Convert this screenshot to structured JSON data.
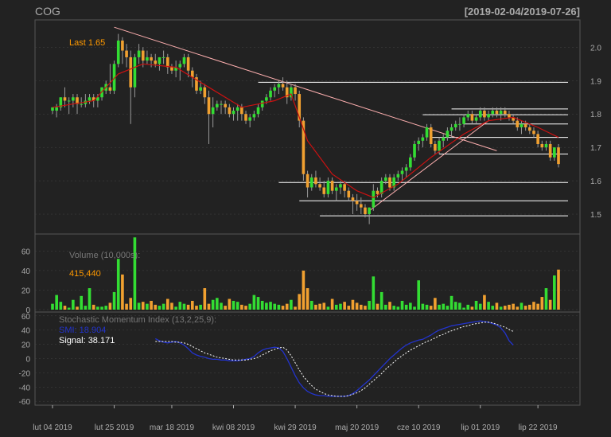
{
  "header": {
    "symbol": "COG",
    "date_range": "[2019-02-04/2019-07-26]"
  },
  "colors": {
    "background": "#222222",
    "grid": "#444444",
    "up": "#33dd33",
    "down": "#f0a030",
    "ma": "#cc1111",
    "trendline": "#ffb0b0",
    "hline": "#ffffff",
    "smi": "#2233cc",
    "signal": "#ffffff",
    "text": "#aaaaaa",
    "accent": "#ff9900"
  },
  "chart_data": [
    {
      "type": "candlestick",
      "title": "COG",
      "annotation": "Last 1.65",
      "ylim": [
        1.45,
        2.07
      ],
      "yticks": [
        "1.5",
        "1.6",
        "1.7",
        "1.8",
        "1.9",
        "2.0"
      ],
      "x_tick_labels": [
        "lut 04 2019",
        "lut 25 2019",
        "mar 18 2019",
        "kwi 08 2019",
        "kwi 29 2019",
        "maj 20 2019",
        "cze 10 2019",
        "lip 01 2019",
        "lip 22 2019"
      ],
      "x_tick_index": [
        0,
        15,
        29,
        44,
        59,
        74,
        89,
        104,
        118
      ],
      "n_bars": 124,
      "ohlc": [
        [
          1.81,
          1.82,
          1.8,
          1.82
        ],
        [
          1.81,
          1.83,
          1.79,
          1.82
        ],
        [
          1.82,
          1.85,
          1.81,
          1.85
        ],
        [
          1.85,
          1.88,
          1.82,
          1.84
        ],
        [
          1.84,
          1.85,
          1.8,
          1.84
        ],
        [
          1.84,
          1.86,
          1.82,
          1.85
        ],
        [
          1.85,
          1.86,
          1.8,
          1.83
        ],
        [
          1.83,
          1.85,
          1.82,
          1.83
        ],
        [
          1.83,
          1.86,
          1.82,
          1.84
        ],
        [
          1.84,
          1.86,
          1.83,
          1.85
        ],
        [
          1.85,
          1.86,
          1.82,
          1.84
        ],
        [
          1.84,
          1.86,
          1.82,
          1.85
        ],
        [
          1.85,
          1.88,
          1.84,
          1.88
        ],
        [
          1.87,
          1.9,
          1.86,
          1.89
        ],
        [
          1.88,
          1.95,
          1.86,
          1.87
        ],
        [
          1.87,
          1.96,
          1.86,
          1.95
        ],
        [
          1.95,
          2.04,
          1.94,
          2.02
        ],
        [
          2.02,
          2.03,
          1.95,
          1.99
        ],
        [
          1.99,
          2.01,
          1.94,
          1.97
        ],
        [
          1.97,
          1.99,
          1.77,
          1.88
        ],
        [
          1.88,
          1.98,
          1.85,
          1.97
        ],
        [
          1.97,
          2.01,
          1.95,
          1.99
        ],
        [
          1.99,
          2.0,
          1.94,
          1.96
        ],
        [
          1.96,
          1.99,
          1.95,
          1.97
        ],
        [
          1.97,
          1.98,
          1.94,
          1.96
        ],
        [
          1.96,
          1.98,
          1.94,
          1.95
        ],
        [
          1.95,
          1.97,
          1.93,
          1.97
        ],
        [
          1.97,
          1.99,
          1.95,
          1.97
        ],
        [
          1.97,
          1.98,
          1.92,
          1.94
        ],
        [
          1.94,
          1.95,
          1.92,
          1.93
        ],
        [
          1.93,
          1.96,
          1.91,
          1.94
        ],
        [
          1.94,
          1.96,
          1.9,
          1.95
        ],
        [
          1.95,
          1.98,
          1.94,
          1.97
        ],
        [
          1.97,
          1.98,
          1.91,
          1.93
        ],
        [
          1.93,
          1.94,
          1.88,
          1.91
        ],
        [
          1.91,
          1.92,
          1.86,
          1.87
        ],
        [
          1.87,
          1.9,
          1.86,
          1.88
        ],
        [
          1.88,
          1.89,
          1.83,
          1.85
        ],
        [
          1.85,
          1.87,
          1.71,
          1.8
        ],
        [
          1.8,
          1.85,
          1.76,
          1.82
        ],
        [
          1.82,
          1.84,
          1.81,
          1.83
        ],
        [
          1.83,
          1.84,
          1.8,
          1.83
        ],
        [
          1.83,
          1.84,
          1.8,
          1.82
        ],
        [
          1.82,
          1.83,
          1.79,
          1.8
        ],
        [
          1.8,
          1.82,
          1.78,
          1.81
        ],
        [
          1.81,
          1.83,
          1.78,
          1.82
        ],
        [
          1.82,
          1.83,
          1.78,
          1.8
        ],
        [
          1.8,
          1.81,
          1.77,
          1.78
        ],
        [
          1.78,
          1.8,
          1.76,
          1.79
        ],
        [
          1.79,
          1.81,
          1.78,
          1.8
        ],
        [
          1.8,
          1.83,
          1.79,
          1.82
        ],
        [
          1.82,
          1.84,
          1.81,
          1.84
        ],
        [
          1.84,
          1.86,
          1.83,
          1.85
        ],
        [
          1.85,
          1.88,
          1.84,
          1.87
        ],
        [
          1.87,
          1.89,
          1.85,
          1.88
        ],
        [
          1.88,
          1.9,
          1.86,
          1.89
        ],
        [
          1.89,
          1.91,
          1.87,
          1.88
        ],
        [
          1.88,
          1.9,
          1.83,
          1.85
        ],
        [
          1.85,
          1.89,
          1.84,
          1.88
        ],
        [
          1.88,
          1.89,
          1.84,
          1.86
        ],
        [
          1.86,
          1.87,
          1.76,
          1.78
        ],
        [
          1.78,
          1.79,
          1.6,
          1.62
        ],
        [
          1.62,
          1.63,
          1.55,
          1.58
        ],
        [
          1.58,
          1.62,
          1.57,
          1.61
        ],
        [
          1.61,
          1.63,
          1.58,
          1.59
        ],
        [
          1.59,
          1.61,
          1.57,
          1.58
        ],
        [
          1.58,
          1.6,
          1.55,
          1.56
        ],
        [
          1.56,
          1.61,
          1.55,
          1.6
        ],
        [
          1.6,
          1.61,
          1.56,
          1.57
        ],
        [
          1.57,
          1.59,
          1.54,
          1.58
        ],
        [
          1.58,
          1.6,
          1.56,
          1.59
        ],
        [
          1.59,
          1.6,
          1.55,
          1.57
        ],
        [
          1.57,
          1.58,
          1.54,
          1.55
        ],
        [
          1.55,
          1.56,
          1.5,
          1.54
        ],
        [
          1.54,
          1.56,
          1.51,
          1.53
        ],
        [
          1.53,
          1.55,
          1.5,
          1.52
        ],
        [
          1.52,
          1.53,
          1.49,
          1.5
        ],
        [
          1.5,
          1.52,
          1.47,
          1.52
        ],
        [
          1.52,
          1.59,
          1.51,
          1.57
        ],
        [
          1.57,
          1.58,
          1.55,
          1.56
        ],
        [
          1.56,
          1.61,
          1.55,
          1.6
        ],
        [
          1.6,
          1.62,
          1.59,
          1.61
        ],
        [
          1.61,
          1.62,
          1.57,
          1.58
        ],
        [
          1.58,
          1.62,
          1.57,
          1.61
        ],
        [
          1.61,
          1.63,
          1.6,
          1.62
        ],
        [
          1.62,
          1.64,
          1.6,
          1.63
        ],
        [
          1.63,
          1.65,
          1.61,
          1.64
        ],
        [
          1.64,
          1.68,
          1.63,
          1.67
        ],
        [
          1.67,
          1.72,
          1.66,
          1.71
        ],
        [
          1.71,
          1.73,
          1.69,
          1.72
        ],
        [
          1.72,
          1.74,
          1.7,
          1.73
        ],
        [
          1.73,
          1.77,
          1.72,
          1.76
        ],
        [
          1.76,
          1.77,
          1.7,
          1.71
        ],
        [
          1.71,
          1.72,
          1.68,
          1.69
        ],
        [
          1.69,
          1.73,
          1.68,
          1.72
        ],
        [
          1.72,
          1.74,
          1.7,
          1.73
        ],
        [
          1.73,
          1.76,
          1.72,
          1.75
        ],
        [
          1.75,
          1.77,
          1.73,
          1.76
        ],
        [
          1.76,
          1.78,
          1.75,
          1.77
        ],
        [
          1.77,
          1.79,
          1.75,
          1.77
        ],
        [
          1.77,
          1.8,
          1.76,
          1.79
        ],
        [
          1.79,
          1.81,
          1.78,
          1.8
        ],
        [
          1.8,
          1.81,
          1.77,
          1.78
        ],
        [
          1.78,
          1.8,
          1.77,
          1.79
        ],
        [
          1.79,
          1.82,
          1.78,
          1.81
        ],
        [
          1.81,
          1.82,
          1.78,
          1.79
        ],
        [
          1.79,
          1.81,
          1.78,
          1.8
        ],
        [
          1.8,
          1.82,
          1.79,
          1.81
        ],
        [
          1.81,
          1.82,
          1.79,
          1.8
        ],
        [
          1.8,
          1.82,
          1.78,
          1.81
        ],
        [
          1.81,
          1.82,
          1.79,
          1.8
        ],
        [
          1.8,
          1.81,
          1.78,
          1.79
        ],
        [
          1.79,
          1.8,
          1.77,
          1.78
        ],
        [
          1.78,
          1.79,
          1.75,
          1.76
        ],
        [
          1.76,
          1.78,
          1.74,
          1.77
        ],
        [
          1.77,
          1.78,
          1.75,
          1.76
        ],
        [
          1.76,
          1.77,
          1.74,
          1.75
        ],
        [
          1.75,
          1.76,
          1.73,
          1.74
        ],
        [
          1.74,
          1.75,
          1.7,
          1.71
        ],
        [
          1.71,
          1.72,
          1.69,
          1.7
        ],
        [
          1.7,
          1.72,
          1.69,
          1.71
        ],
        [
          1.71,
          1.72,
          1.66,
          1.67
        ],
        [
          1.67,
          1.7,
          1.66,
          1.7
        ],
        [
          1.7,
          1.71,
          1.64,
          1.65
        ]
      ],
      "ma_line": [
        [
          0,
          1.82
        ],
        [
          10,
          1.84
        ],
        [
          16,
          1.92
        ],
        [
          22,
          1.95
        ],
        [
          30,
          1.94
        ],
        [
          38,
          1.88
        ],
        [
          46,
          1.82
        ],
        [
          54,
          1.84
        ],
        [
          58,
          1.86
        ],
        [
          62,
          1.72
        ],
        [
          68,
          1.62
        ],
        [
          74,
          1.57
        ],
        [
          78,
          1.55
        ],
        [
          84,
          1.59
        ],
        [
          92,
          1.67
        ],
        [
          100,
          1.74
        ],
        [
          106,
          1.78
        ],
        [
          112,
          1.79
        ],
        [
          118,
          1.76
        ],
        [
          123,
          1.73
        ]
      ],
      "trendlines": [
        {
          "from": [
            15,
            2.06
          ],
          "to": [
            108,
            1.69
          ]
        },
        {
          "from": [
            77,
            1.51
          ],
          "to": [
            106,
            1.78
          ]
        }
      ],
      "hlines": [
        {
          "y": 1.895,
          "x_from": 50,
          "x_to": 123
        },
        {
          "y": 1.815,
          "x_from": 97,
          "x_to": 123
        },
        {
          "y": 1.798,
          "x_from": 90,
          "x_to": 123
        },
        {
          "y": 1.77,
          "x_from": 100,
          "x_to": 123
        },
        {
          "y": 1.73,
          "x_from": 92,
          "x_to": 123
        },
        {
          "y": 1.68,
          "x_from": 94,
          "x_to": 123
        },
        {
          "y": 1.595,
          "x_from": 55,
          "x_to": 123
        },
        {
          "y": 1.54,
          "x_from": 60,
          "x_to": 123
        },
        {
          "y": 1.495,
          "x_from": 65,
          "x_to": 123
        }
      ]
    },
    {
      "type": "bar",
      "title": "Volume (10,000s):",
      "annotation": "415,440",
      "ylim": [
        0,
        75
      ],
      "yticks": [
        "0",
        "20",
        "40",
        "60"
      ],
      "volume": [
        6,
        15,
        8,
        4,
        2,
        10,
        3,
        14,
        4,
        22,
        5,
        3,
        3,
        4,
        7,
        18,
        52,
        36,
        6,
        12,
        74,
        7,
        8,
        6,
        9,
        5,
        4,
        6,
        11,
        7,
        3,
        8,
        6,
        5,
        9,
        4,
        5,
        22,
        6,
        10,
        12,
        7,
        4,
        11,
        9,
        8,
        5,
        4,
        6,
        15,
        13,
        9,
        7,
        8,
        6,
        5,
        4,
        6,
        10,
        3,
        16,
        40,
        22,
        9,
        5,
        6,
        7,
        3,
        11,
        5,
        6,
        8,
        4,
        10,
        7,
        5,
        4,
        9,
        34,
        6,
        18,
        5,
        8,
        4,
        3,
        9,
        5,
        7,
        3,
        30,
        6,
        5,
        4,
        12,
        5,
        6,
        4,
        14,
        8,
        7,
        2,
        5,
        3,
        9,
        6,
        15,
        8,
        4,
        7,
        3,
        4,
        5,
        6,
        3,
        7,
        4,
        5,
        8,
        6,
        13,
        22,
        10,
        35,
        41
      ]
    },
    {
      "type": "line",
      "title": "Stochastic Momentum Index (13,2,25,9):",
      "ylim": [
        -62,
        62
      ],
      "yticks": [
        "-60",
        "-40",
        "-20",
        "0",
        "20",
        "40",
        "60"
      ],
      "start_index": 25,
      "series": [
        {
          "name": "SMI: 18.904",
          "values": [
            28,
            25,
            23,
            22,
            23,
            24,
            22,
            19,
            14,
            8,
            5,
            3,
            2,
            0,
            -1,
            -1,
            -2,
            -2,
            -3,
            -3,
            -3,
            -2,
            -1,
            0,
            3,
            8,
            12,
            14,
            15,
            16,
            15,
            10,
            0,
            -12,
            -24,
            -34,
            -41,
            -46,
            -49,
            -51,
            -52,
            -52,
            -53,
            -53,
            -53,
            -53,
            -53,
            -52,
            -49,
            -45,
            -40,
            -35,
            -30,
            -24,
            -18,
            -12,
            -6,
            0,
            5,
            10,
            15,
            19,
            22,
            24,
            26,
            27,
            30,
            33,
            37,
            40,
            42,
            44,
            46,
            47,
            48,
            49,
            50,
            51,
            52,
            53,
            52,
            51,
            49,
            47,
            43,
            36,
            25,
            19
          ]
        },
        {
          "name": "Signal: 38.171",
          "values": [
            24,
            24,
            24,
            24,
            24,
            23,
            23,
            22,
            20,
            17,
            14,
            11,
            8,
            6,
            4,
            2,
            1,
            0,
            -1,
            -2,
            -2,
            -2,
            -2,
            -1,
            0,
            2,
            5,
            8,
            11,
            13,
            15,
            16,
            12,
            4,
            -6,
            -16,
            -25,
            -32,
            -38,
            -43,
            -46,
            -49,
            -51,
            -52,
            -53,
            -53,
            -53,
            -52,
            -50,
            -48,
            -45,
            -41,
            -36,
            -31,
            -26,
            -21,
            -15,
            -10,
            -5,
            0,
            4,
            8,
            12,
            15,
            18,
            21,
            24,
            26,
            29,
            32,
            34,
            37,
            39,
            41,
            43,
            45,
            46,
            48,
            49,
            50,
            51,
            51,
            50,
            48,
            46,
            44,
            41,
            38
          ]
        }
      ]
    }
  ]
}
